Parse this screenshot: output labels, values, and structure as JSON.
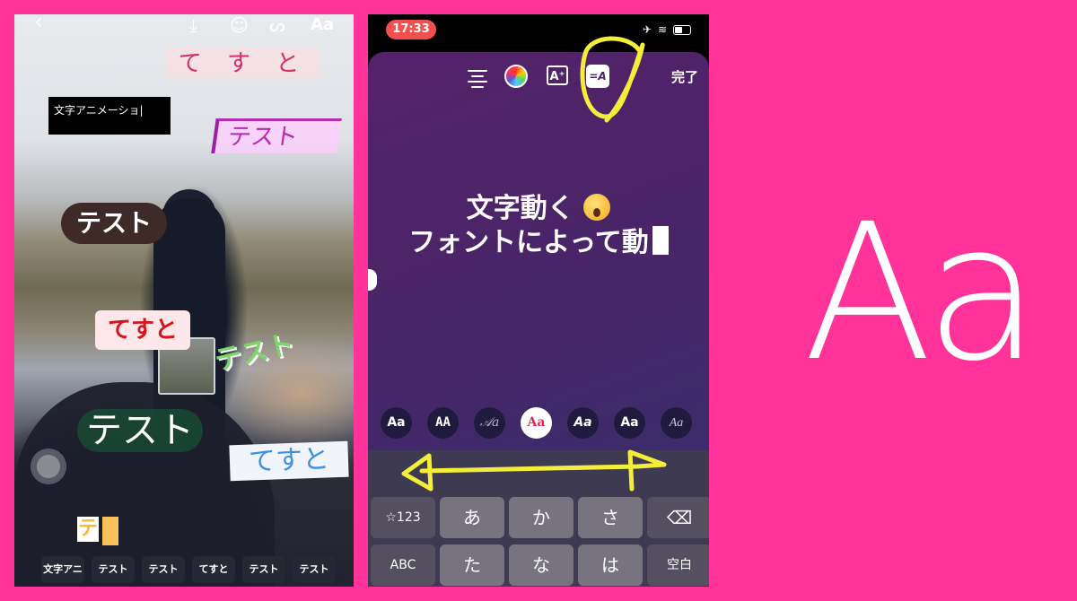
{
  "left_screen": {
    "top_icons": [
      {
        "name": "back-icon",
        "glyph": "‹"
      },
      {
        "name": "download-icon",
        "glyph": "⤓"
      },
      {
        "name": "sticker-icon",
        "glyph": "☺"
      },
      {
        "name": "draw-icon",
        "glyph": "ᔕ"
      },
      {
        "name": "text-icon",
        "glyph": "Aa"
      }
    ],
    "stickers": [
      "て す と",
      "文字アニメーショ|",
      "テスト",
      "テスト",
      "てすと",
      "テスト",
      "テスト",
      "てすと",
      "テ"
    ],
    "layers": [
      "文字アニ",
      "テスト",
      "テスト",
      "てすと",
      "テスト",
      "テスト"
    ]
  },
  "right_screen": {
    "status": {
      "time": "17:33",
      "airplane": "✈",
      "wifi": "≋"
    },
    "toolbar": {
      "align_icon": "align-center-icon",
      "color_icon": "color-wheel-icon",
      "effect_label": "A⁺",
      "animate_label": "=A",
      "done_label": "完了"
    },
    "text": {
      "line1": "文字動く",
      "line2": "フォントによって動"
    },
    "fonts": [
      {
        "label": "Aa",
        "active": false
      },
      {
        "label": "AA",
        "active": false
      },
      {
        "label": "𝒜a",
        "active": false
      },
      {
        "label": "Aa",
        "active": true
      },
      {
        "label": "Aa",
        "active": false
      },
      {
        "label": "Aa",
        "active": false
      },
      {
        "label": "Aa",
        "active": false
      }
    ],
    "keyboard": {
      "row1": [
        "☆123",
        "あ",
        "か",
        "さ",
        "⌫"
      ],
      "row2": [
        "ABC",
        "た",
        "な",
        "は",
        "空白"
      ]
    }
  },
  "big_label": "Aa",
  "colors": {
    "background": "#ff3399",
    "annotation": "#f4ee3a",
    "time_pill": "#f1504f"
  }
}
